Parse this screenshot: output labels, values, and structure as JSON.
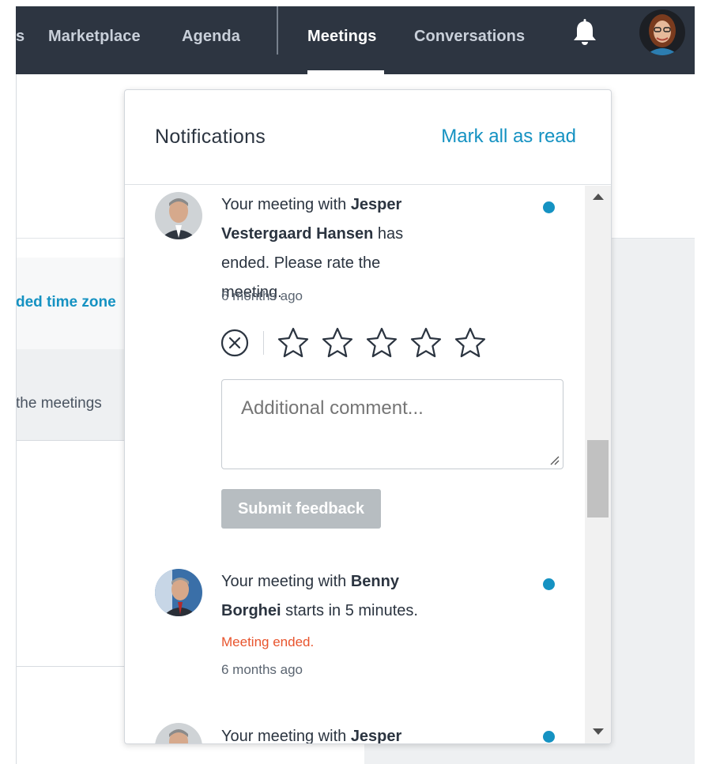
{
  "nav": {
    "partial_item": "s",
    "items": [
      {
        "label": "Marketplace",
        "active": false
      },
      {
        "label": "Agenda",
        "active": false
      },
      {
        "label": "Meetings",
        "active": true
      },
      {
        "label": "Conversations",
        "active": false
      }
    ],
    "bell_icon": "bell-icon",
    "avatar_icon": "user-avatar"
  },
  "background": {
    "link_fragment": "ded time zone",
    "text_fragment": "the meetings"
  },
  "notifications": {
    "title": "Notifications",
    "mark_all_label": "Mark all as read",
    "items": [
      {
        "prefix": "Your meeting with ",
        "name": "Jesper Vestergaard Hansen",
        "suffix": " has ended. Please rate the meeting.",
        "time": "6 months ago",
        "unread": true,
        "comment_placeholder": "Additional comment...",
        "submit_label": "Submit feedback",
        "stars": 5
      },
      {
        "prefix": "Your meeting with ",
        "name": "Benny Borghei",
        "suffix": " starts in 5 minutes.",
        "status": "Meeting ended.",
        "time": "6 months ago",
        "unread": true
      },
      {
        "prefix": "Your meeting with ",
        "name": "Jesper",
        "unread": true
      }
    ]
  },
  "colors": {
    "nav_bg": "#2d3541",
    "accent": "#1592c2",
    "ended": "#e8542d",
    "button_disabled": "#b7bdc1"
  }
}
